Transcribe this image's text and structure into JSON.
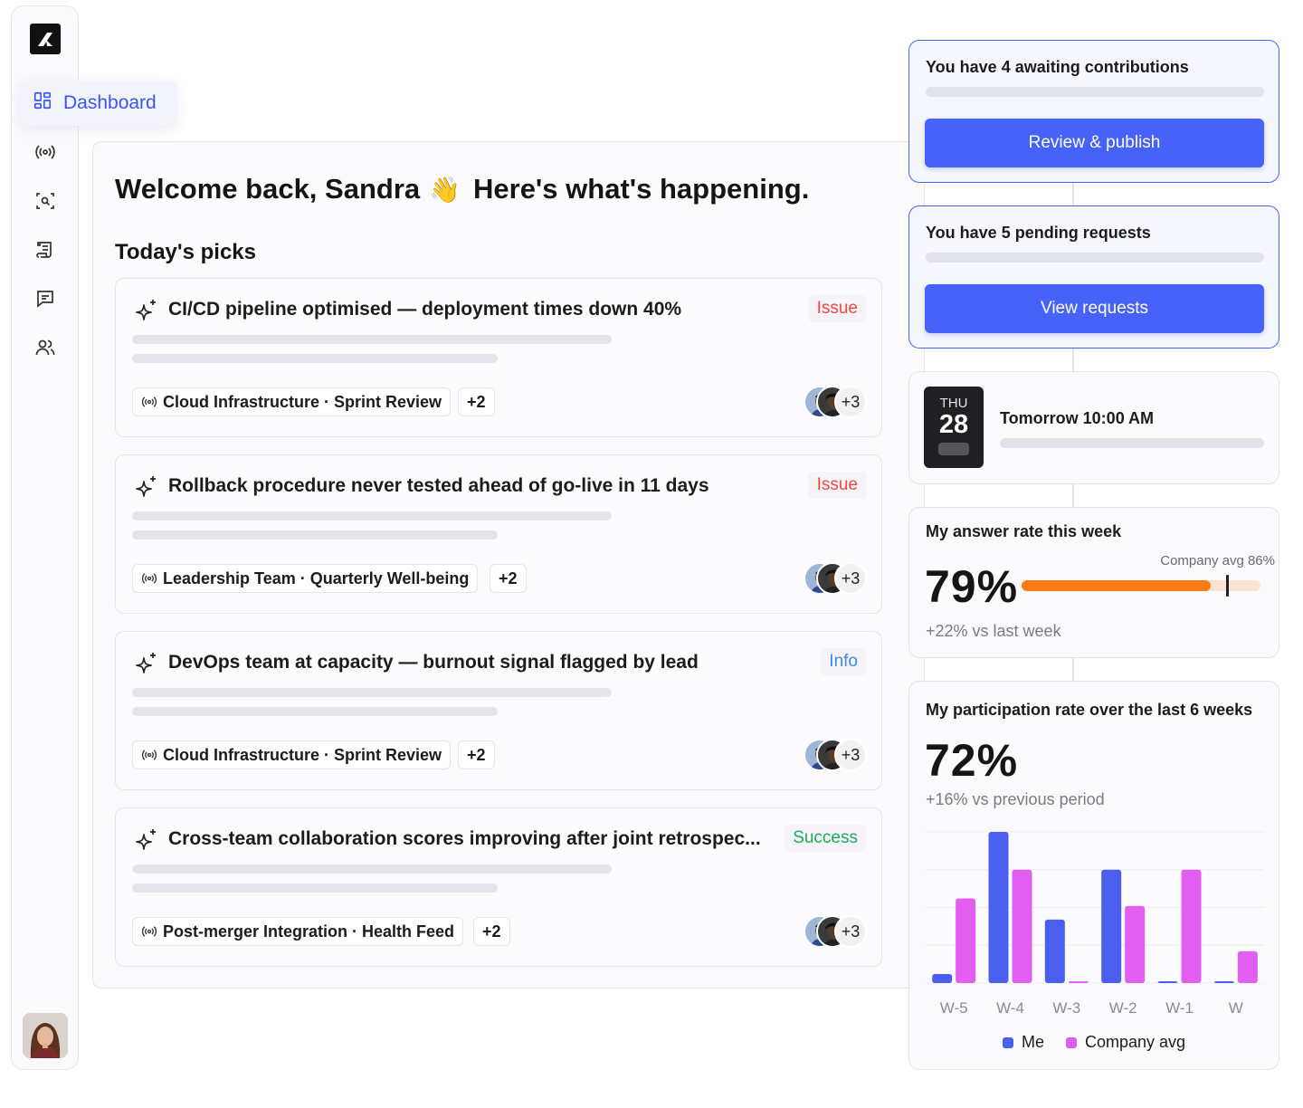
{
  "sidebar": {
    "active_item": "Dashboard",
    "icons": [
      "dashboard-icon",
      "broadcast-icon",
      "scan-search-icon",
      "scroll-icon",
      "message-icon",
      "users-icon"
    ]
  },
  "welcome": {
    "text": "Welcome back, Sandra",
    "emoji": "👋",
    "subtext": "Here's what's happening."
  },
  "picks": {
    "title": "Today's picks",
    "items": [
      {
        "title": "CI/CD pipeline optimised — deployment times down 40%",
        "badge": "Issue",
        "badge_type": "issue",
        "tag": "Cloud Infrastructure · Sprint Review",
        "more_tags": "+2",
        "more_people": "+3"
      },
      {
        "title": "Rollback procedure never tested ahead of go-live in 11 days",
        "badge": "Issue",
        "badge_type": "issue",
        "tag": "Leadership Team · Quarterly Well-being",
        "more_tags": "+2",
        "more_people": "+3"
      },
      {
        "title": "DevOps team at capacity — burnout signal flagged by lead",
        "badge": "Info",
        "badge_type": "info",
        "tag": "Cloud Infrastructure · Sprint Review",
        "more_tags": "+2",
        "more_people": "+3"
      },
      {
        "title": "Cross-team collaboration scores improving after joint retrospec...",
        "badge": "Success",
        "badge_type": "success",
        "tag": "Post-merger Integration · Health Feed",
        "more_tags": "+2",
        "more_people": "+3"
      }
    ]
  },
  "contributions": {
    "title": "You have 4 awaiting contributions",
    "button": "Review & publish"
  },
  "requests": {
    "title": "You have 5 pending requests",
    "button": "View requests"
  },
  "event": {
    "day": "THU",
    "date": "28",
    "time": "Tomorrow 10:00 AM"
  },
  "answer_rate": {
    "title": "My answer rate this week",
    "value": "79%",
    "percent": 79,
    "company_label": "Company avg 86%",
    "company_percent": 86,
    "delta": "+22% vs last week"
  },
  "participation": {
    "title": "My participation rate over the last 6 weeks",
    "value": "72%",
    "delta": "+16% vs previous period"
  },
  "colors": {
    "accent": "#4762f8",
    "orange": "#ff7b16",
    "me": "#4a5ff0",
    "company": "#e15ef0"
  },
  "chart_data": {
    "type": "bar",
    "categories": [
      "W-5",
      "W-4",
      "W-3",
      "W-2",
      "W-1",
      "W"
    ],
    "series": [
      {
        "name": "Me",
        "values": [
          6,
          100,
          42,
          75,
          1,
          1
        ]
      },
      {
        "name": "Company avg",
        "values": [
          56,
          75,
          1,
          51,
          75,
          21
        ]
      }
    ],
    "ylim": [
      0,
      100
    ],
    "grid": true,
    "legend_position": "bottom"
  }
}
